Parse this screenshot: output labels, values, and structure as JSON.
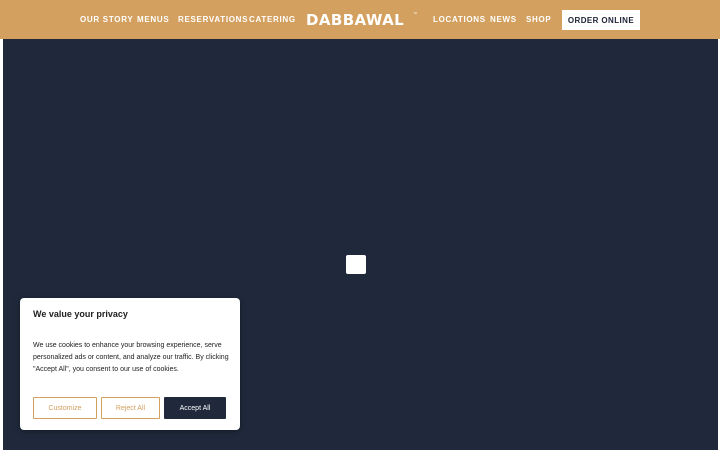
{
  "nav": {
    "left_links": [
      "OUR STORY",
      "MENUS",
      "RESERVATIONS",
      "CATERING"
    ],
    "logo_text": "DABBAWAL",
    "logo_mark": "™",
    "right_links": [
      "LOCATIONS",
      "NEWS",
      "SHOP"
    ],
    "order_button": "ORDER ONLINE"
  },
  "cookie_banner": {
    "title": "We value your privacy",
    "body": "We use cookies to enhance your browsing experience, serve personalized ads or content, and analyze our traffic. By clicking \"Accept All\", you consent to our use of cookies.",
    "customize": "Customize",
    "reject": "Reject All",
    "accept": "Accept All"
  },
  "colors": {
    "brand_gold": "#d3a05f",
    "hero_navy": "#1f293b",
    "white": "#ffffff"
  },
  "icons": {
    "loader": "loading-spinner-icon"
  }
}
